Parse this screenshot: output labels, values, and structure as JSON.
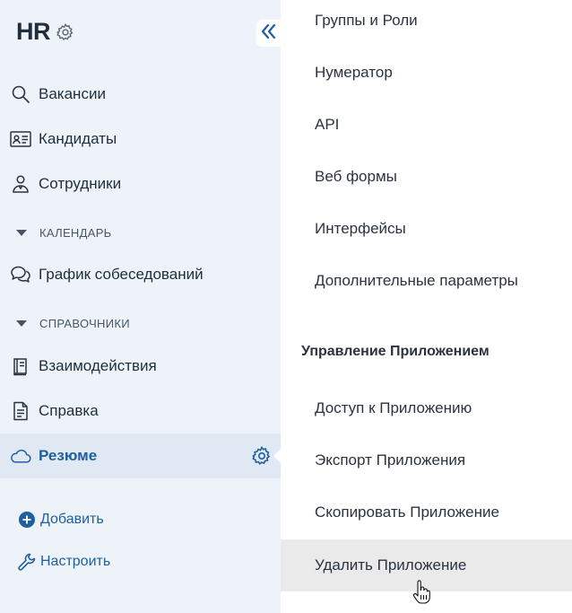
{
  "brand": {
    "title": "HR",
    "gear_icon": "gear-icon"
  },
  "sidebar": {
    "collapse_icon": "double-chevron-left-icon",
    "items": [
      {
        "label": "Вакансии",
        "icon": "search-icon"
      },
      {
        "label": "Кандидаты",
        "icon": "id-card-icon"
      },
      {
        "label": "Сотрудники",
        "icon": "employee-icon"
      },
      {
        "label": "График собеседований",
        "icon": "chat-bubbles-icon"
      },
      {
        "label": "Взаимодействия",
        "icon": "book-icon"
      },
      {
        "label": "Справка",
        "icon": "document-icon"
      },
      {
        "label": "Резюме",
        "icon": "cloud-icon",
        "active": true
      }
    ],
    "sections": [
      {
        "label": "КАЛЕНДАРЬ"
      },
      {
        "label": "СПРАВОЧНИКИ"
      }
    ],
    "actions": {
      "add_label": "Добавить",
      "configure_label": "Настроить"
    }
  },
  "menu": {
    "items_top": [
      "Группы и Роли",
      "Нумератор",
      "API",
      "Веб формы",
      "Интерфейсы",
      "Дополнительные параметры"
    ],
    "group_title": "Управление Приложением",
    "items_bottom": [
      "Доступ к Приложению",
      "Экспорт Приложения",
      "Скопировать Приложение",
      "Удалить Приложение"
    ]
  },
  "colors": {
    "sidebar_bg": "#eef3f9",
    "active_bg": "#dfe8f3",
    "accent": "#1f5fa0",
    "menu_bg": "#ffffff",
    "hover_bg": "#eaeaea"
  }
}
